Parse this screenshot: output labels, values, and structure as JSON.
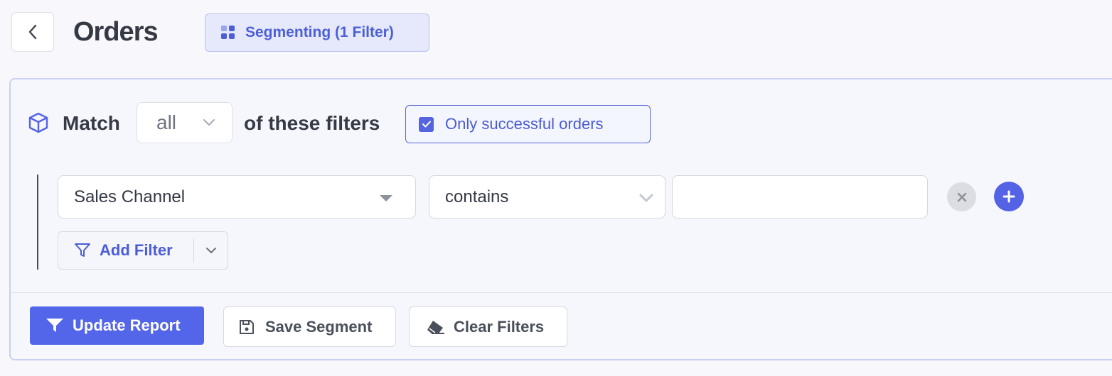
{
  "header": {
    "title": "Orders",
    "segment_label": "Segmenting (1 Filter)"
  },
  "filter_panel": {
    "match_label": "Match",
    "match_mode": "all",
    "match_suffix": "of these filters",
    "only_successful_label": "Only successful orders",
    "only_successful_checked": true,
    "rules": [
      {
        "field": "Sales Channel",
        "operator": "contains",
        "value": ""
      }
    ],
    "add_filter_label": "Add Filter"
  },
  "footer": {
    "update_label": "Update Report",
    "save_label": "Save Segment",
    "clear_label": "Clear Filters"
  },
  "colors": {
    "accent": "#5365e8",
    "segment_bg": "#e6e9fb",
    "text_dark": "#343944"
  },
  "icons": {
    "back": "chevron-left-icon",
    "segment": "grid-icon",
    "match": "cube-icon",
    "checkbox": "check-icon",
    "remove": "close-icon",
    "add": "plus-icon",
    "filter": "funnel-icon",
    "save": "floppy-disk-icon",
    "clear": "eraser-icon"
  }
}
